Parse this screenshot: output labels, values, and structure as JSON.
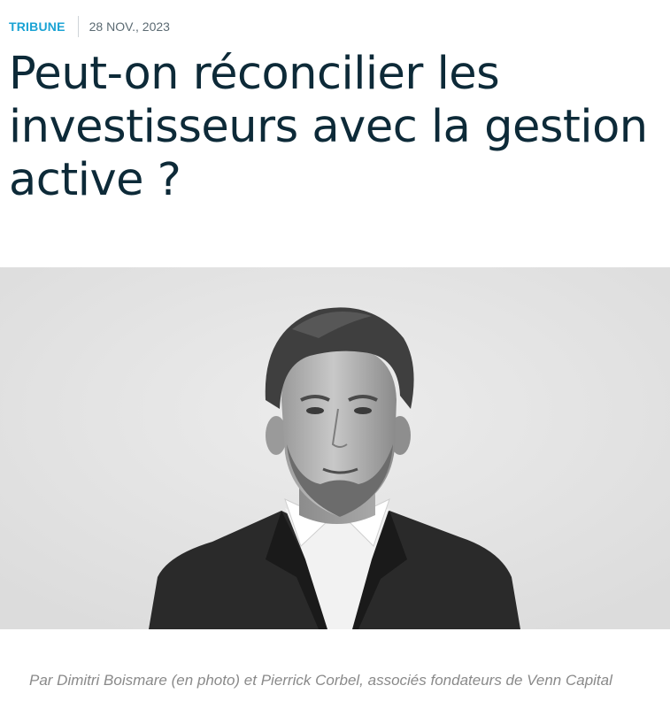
{
  "article": {
    "category": "TRIBUNE",
    "date": "28 NOV., 2023",
    "title": "Peut-on réconcilier les investisseurs avec la gestion active ?",
    "caption": "Par Dimitri Boismare (en photo) et Pierrick Corbel, associés fondateurs de Venn Capital"
  },
  "photo": {
    "subject": "portrait-photo",
    "style": "black-and-white"
  },
  "colors": {
    "category": "#1ba3d4",
    "title": "#0d2a38",
    "date": "#5c6b73",
    "caption": "#8a8a8a",
    "photo_background": "#e6e6e6"
  }
}
